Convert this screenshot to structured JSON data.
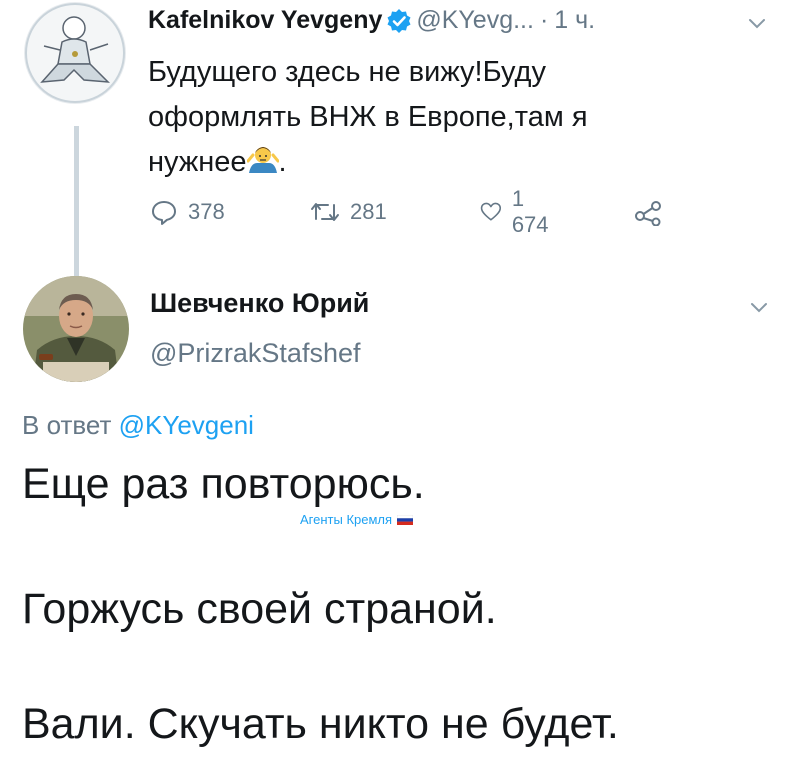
{
  "tweet1": {
    "author_name": "Kafelnikov Yevgeny",
    "handle": "@KYevg...",
    "separator": "·",
    "time": "1 ч.",
    "text": "Будущего здесь не вижу!Буду оформлять ВНЖ в Европе,там я нужнее",
    "text_suffix": ".",
    "emoji": "person-shrugging-emoji",
    "replies": "378",
    "retweets": "281",
    "likes": "1 674"
  },
  "tweet2": {
    "author_name": "Шевченко Юрий",
    "handle": "@PrizrakStafshef",
    "reply_prefix": "В ответ",
    "reply_mention": "@KYevgeni",
    "lines": [
      "Еще раз повторюсь.",
      "Горжусь своей страной.",
      "Вали. Скучать никто не будет."
    ]
  },
  "watermark": {
    "text": "Агенты Кремля"
  },
  "colors": {
    "accent": "#1da1f2",
    "secondary_text": "#657786",
    "thread_line": "#ccd6dd",
    "primary_text": "#14171a"
  }
}
